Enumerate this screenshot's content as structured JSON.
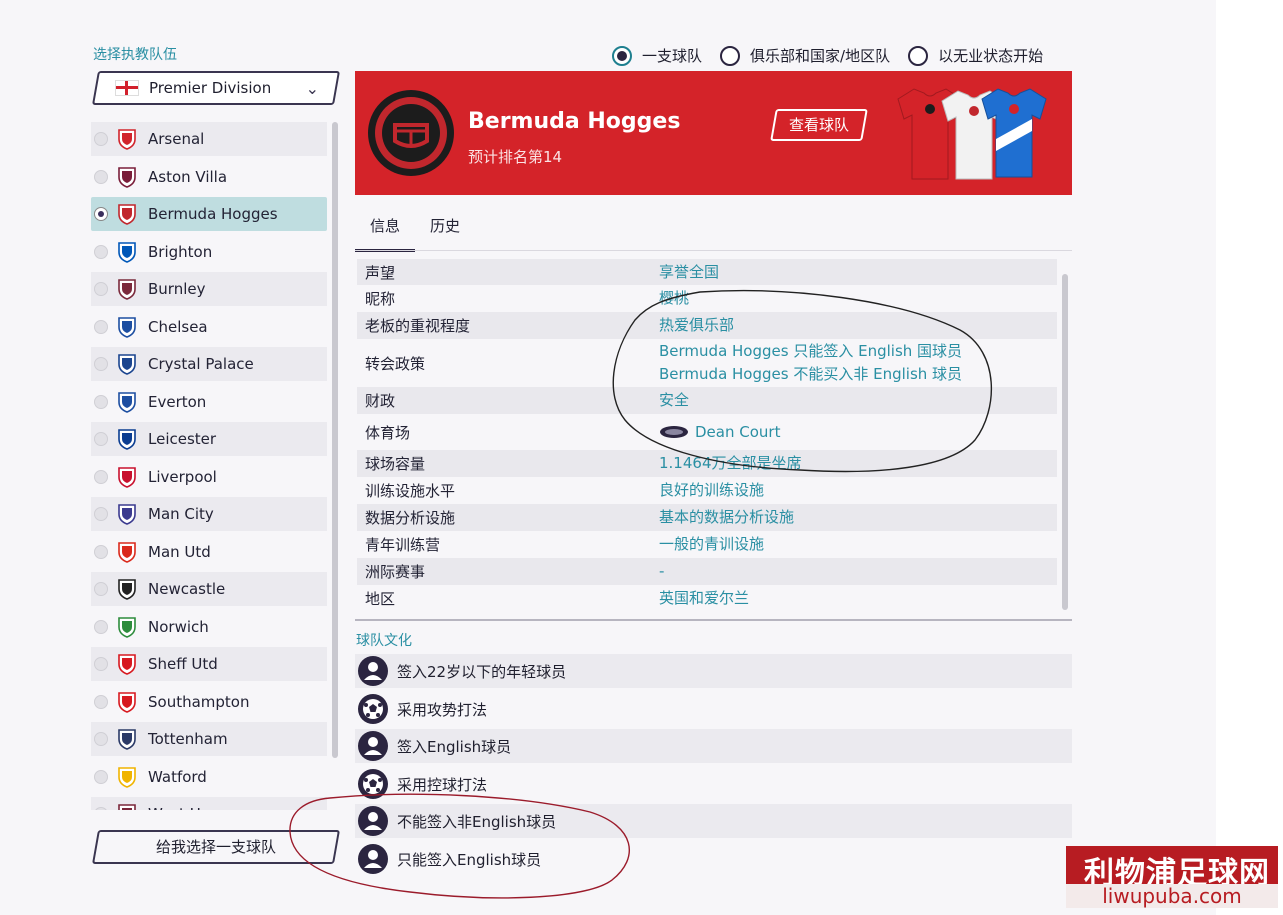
{
  "left": {
    "title": "选择执教队伍",
    "league": "Premier Division",
    "teams": [
      {
        "name": "Arsenal",
        "color": "#d1242c"
      },
      {
        "name": "Aston Villa",
        "color": "#7a1e3a"
      },
      {
        "name": "Bermuda Hogges",
        "color": "#c1272d"
      },
      {
        "name": "Brighton",
        "color": "#0057b8"
      },
      {
        "name": "Burnley",
        "color": "#7b2a3c"
      },
      {
        "name": "Chelsea",
        "color": "#1d4ea1"
      },
      {
        "name": "Crystal Palace",
        "color": "#1b458f"
      },
      {
        "name": "Everton",
        "color": "#1d4ea1"
      },
      {
        "name": "Leicester",
        "color": "#0b3d91"
      },
      {
        "name": "Liverpool",
        "color": "#c8102e"
      },
      {
        "name": "Man City",
        "color": "#3b3a8f"
      },
      {
        "name": "Man Utd",
        "color": "#da291c"
      },
      {
        "name": "Newcastle",
        "color": "#222222"
      },
      {
        "name": "Norwich",
        "color": "#2d8c3c"
      },
      {
        "name": "Sheff Utd",
        "color": "#d71920"
      },
      {
        "name": "Southampton",
        "color": "#d71920"
      },
      {
        "name": "Tottenham",
        "color": "#2b3a67"
      },
      {
        "name": "Watford",
        "color": "#f0b400"
      },
      {
        "name": "West H...",
        "color": "#7a263a"
      }
    ],
    "choose_button": "给我选择一支球队"
  },
  "options": [
    "一支球队",
    "俱乐部和国家/地区队",
    "以无业状态开始"
  ],
  "banner": {
    "club_name": "Bermuda Hogges",
    "prediction": "预计排名第14",
    "view_button": "查看球队"
  },
  "tabs": [
    "信息",
    "历史"
  ],
  "info": {
    "rows": [
      {
        "key": "声望",
        "value": "享誉全国"
      },
      {
        "key": "昵称",
        "value": "樱桃"
      },
      {
        "key": "老板的重视程度",
        "value": "热爱俱乐部"
      },
      {
        "key": "转会政策",
        "value": "Bermuda Hogges 只能签入 English 国球员",
        "value2": "Bermuda Hogges 不能买入非 English 球员"
      },
      {
        "key": "财政",
        "value": "安全"
      },
      {
        "key": "体育场",
        "value": "Dean Court"
      },
      {
        "key": "球场容量",
        "value": "1.1464万全部是坐席"
      },
      {
        "key": "训练设施水平",
        "value": "良好的训练设施"
      },
      {
        "key": "数据分析设施",
        "value": "基本的数据分析设施"
      },
      {
        "key": "青年训练营",
        "value": "一般的青训设施"
      },
      {
        "key": "洲际赛事",
        "value": "-"
      },
      {
        "key": "地区",
        "value": "英国和爱尔兰"
      }
    ]
  },
  "culture": {
    "title": "球队文化",
    "items": [
      {
        "label": "签入22岁以下的年轻球员",
        "icon": "person-icon"
      },
      {
        "label": "采用攻势打法",
        "icon": "football-icon"
      },
      {
        "label": "签入English球员",
        "icon": "person-icon"
      },
      {
        "label": "采用控球打法",
        "icon": "football-icon"
      },
      {
        "label": "不能签入非English球员",
        "icon": "person-icon"
      },
      {
        "label": "只能签入English球员",
        "icon": "person-icon"
      }
    ]
  },
  "watermark": {
    "cn": "利物浦足球网",
    "en": "liwupuba.com"
  },
  "colors": {
    "accent": "#2a8fa3",
    "banner": "#d42329",
    "dark": "#2b2540"
  }
}
